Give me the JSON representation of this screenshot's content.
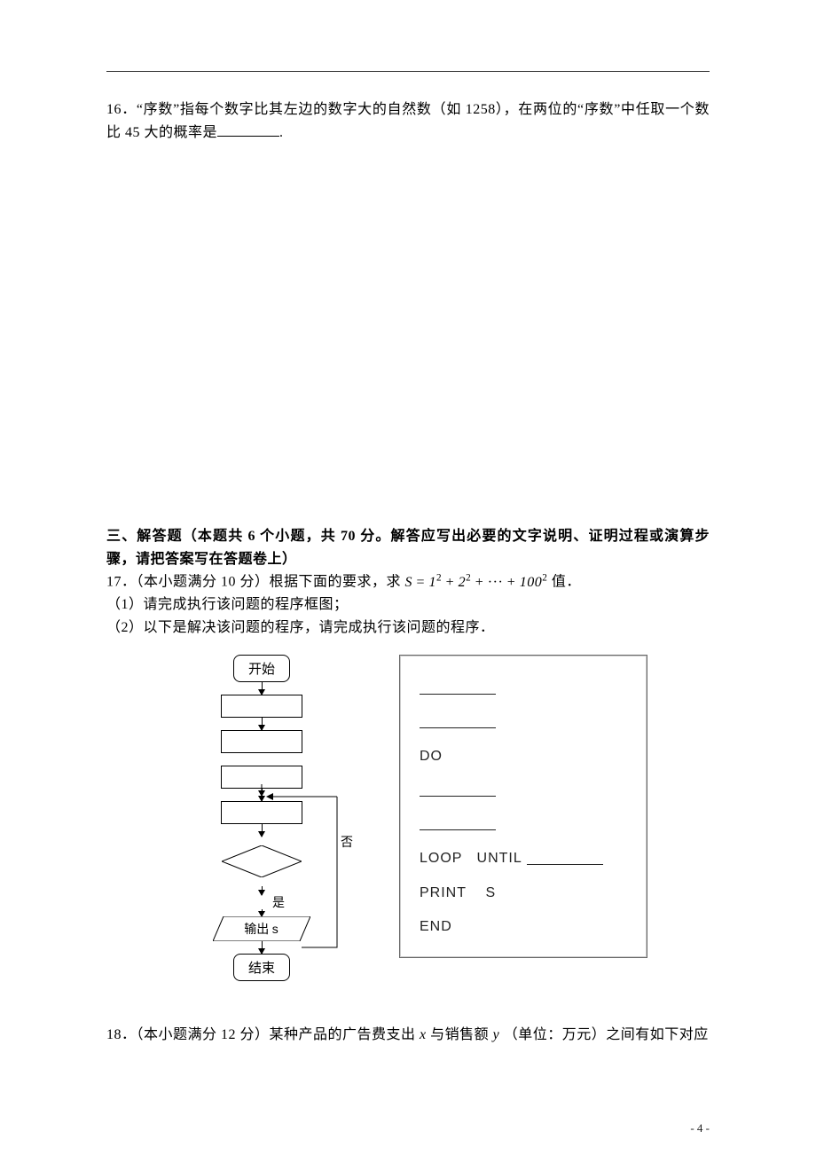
{
  "q16": {
    "num": "16．",
    "text_a": "“序数”指每个数字比其左边的数字大的自然数（如 1258），在两位的“序数”中任取一个数比 45 大的概率是",
    "text_b": "."
  },
  "section3": {
    "heading": "三、解答题（本题共 6 个小题，共 70 分。解答应写出必要的文字说明、证明过程或演算步骤，请把答案写在答题卷上）"
  },
  "q17": {
    "intro_a": "17．（本小题满分 10 分）根据下面的要求，求",
    "formula": "S = 1² + 2² + ··· + 100²",
    "intro_b": " 值．",
    "sub1": "（1）请完成执行该问题的程序框图；",
    "sub2": "（2）以下是解决该问题的程序，请完成执行该问题的程序．"
  },
  "flowchart": {
    "start": "开始",
    "no_label": "否",
    "yes_label": "是",
    "output_prefix": "输出 ",
    "output_var": "s",
    "end": "结束"
  },
  "code": {
    "do": "DO",
    "loop_until": "LOOP   UNTIL ",
    "print": "PRINT    S",
    "end": "END"
  },
  "q18": {
    "text": "18．（本小题满分 12 分）某种产品的广告费支出 x 与销售额 y（单位：万元）之间有如下对应"
  },
  "page_number": "- 4 -",
  "chart_data": {
    "type": "flowchart",
    "description": "Algorithm flowchart to compute S = sum of i^2 for i = 1..100",
    "nodes": [
      {
        "id": "start",
        "shape": "terminal",
        "label": "开始"
      },
      {
        "id": "init1",
        "shape": "process",
        "label": "(blank)"
      },
      {
        "id": "init2",
        "shape": "process",
        "label": "(blank)"
      },
      {
        "id": "loop_merge",
        "shape": "merge",
        "label": ""
      },
      {
        "id": "body1",
        "shape": "process",
        "label": "(blank)"
      },
      {
        "id": "body2",
        "shape": "process",
        "label": "(blank)"
      },
      {
        "id": "cond",
        "shape": "decision",
        "label": "(blank)"
      },
      {
        "id": "out",
        "shape": "io",
        "label": "输出 s"
      },
      {
        "id": "end",
        "shape": "terminal",
        "label": "结束"
      }
    ],
    "edges": [
      {
        "from": "start",
        "to": "init1"
      },
      {
        "from": "init1",
        "to": "init2"
      },
      {
        "from": "init2",
        "to": "loop_merge"
      },
      {
        "from": "loop_merge",
        "to": "body1"
      },
      {
        "from": "body1",
        "to": "body2"
      },
      {
        "from": "body2",
        "to": "cond"
      },
      {
        "from": "cond",
        "to": "out",
        "label": "是"
      },
      {
        "from": "cond",
        "to": "loop_merge",
        "label": "否"
      },
      {
        "from": "out",
        "to": "end"
      }
    ],
    "pseudocode": [
      "____",
      "____",
      "DO",
      "____",
      "____",
      "LOOP UNTIL ____",
      "PRINT S",
      "END"
    ]
  }
}
